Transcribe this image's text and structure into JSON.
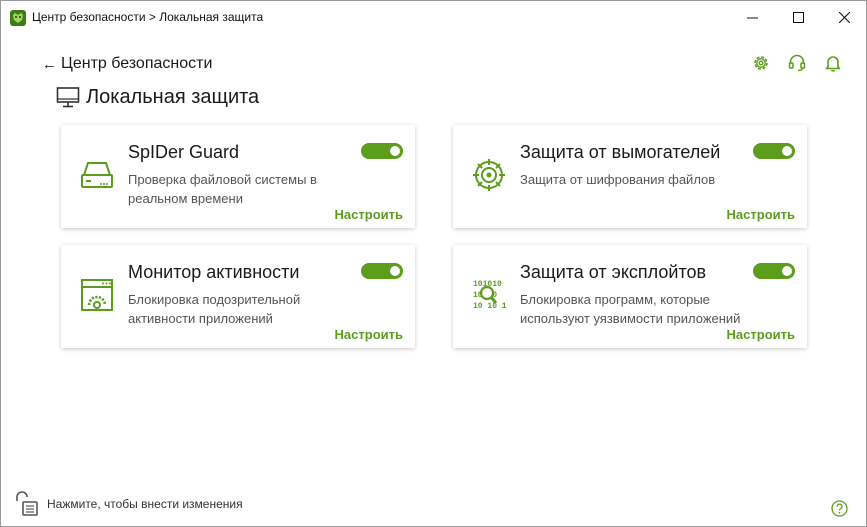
{
  "window": {
    "title": "Центр безопасности > Локальная защита",
    "accent_color": "#5c9e1c"
  },
  "nav": {
    "back_label": "Центр безопасности"
  },
  "top_icons": [
    "settings-icon",
    "support-headset-icon",
    "notifications-bell-icon"
  ],
  "page": {
    "title": "Локальная защита"
  },
  "cards": [
    {
      "title": "SpIDer Guard",
      "description": "Проверка файловой системы в реальном времени",
      "link": "Настроить",
      "enabled": true,
      "icon": "hard-drive-icon"
    },
    {
      "title": "Защита от вымогателей",
      "description": "Защита от шифрования файлов",
      "link": "Настроить",
      "enabled": true,
      "icon": "ransomware-shield-icon"
    },
    {
      "title": "Монитор активности",
      "description": "Блокировка подозрительной активности приложений",
      "link": "Настроить",
      "enabled": true,
      "icon": "activity-monitor-icon"
    },
    {
      "title": "Защита от эксплойтов",
      "description": "Блокировка программ, которые используют уязвимости приложений",
      "link": "Настроить",
      "enabled": true,
      "icon": "exploit-scan-icon",
      "icon_text": [
        "101010",
        "10 10",
        "10 10 10"
      ]
    }
  ],
  "footer": {
    "text": "Нажмите, чтобы внести изменения"
  }
}
